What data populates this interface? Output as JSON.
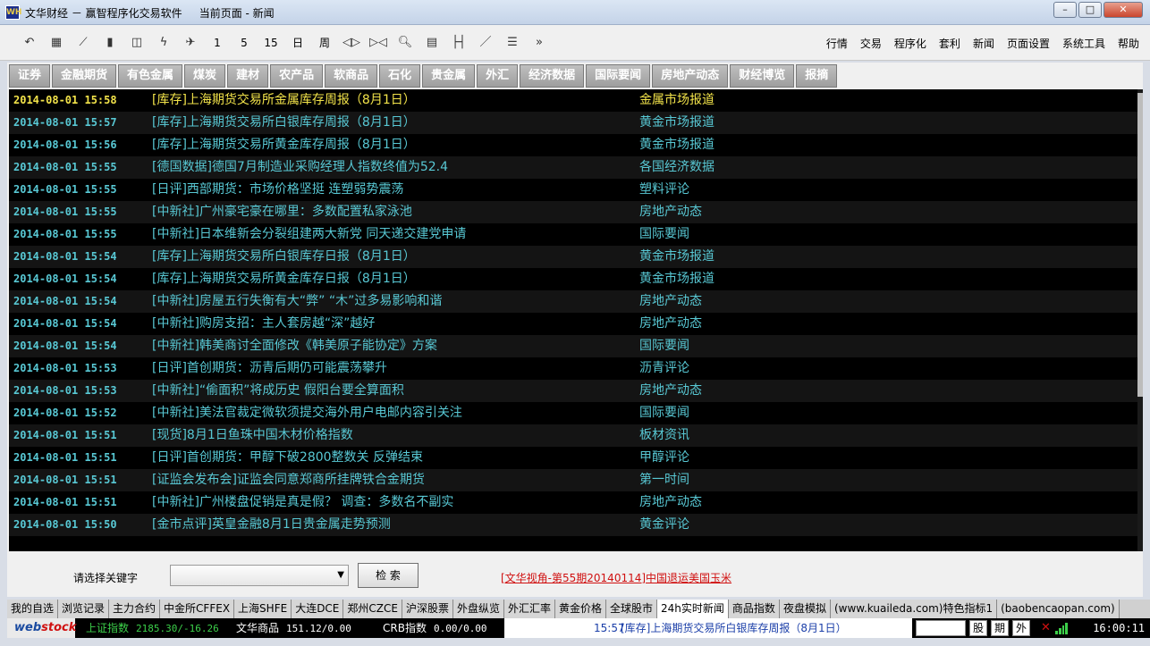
{
  "window": {
    "title": "文华财经 － 赢智程序化交易软件     当前页面 - 新闻",
    "icon_text": "WH",
    "controls": [
      "minimize",
      "maximize",
      "close"
    ]
  },
  "toolbar": {
    "icons": [
      "undo-icon",
      "table-icon",
      "line-chart-icon",
      "candle-icon",
      "split-icon",
      "lightning-icon",
      "plane-icon"
    ],
    "periods": [
      "1",
      "5",
      "15",
      "日",
      "周"
    ],
    "tools": [
      "arrows-icon",
      "arrows2-icon",
      "search-icon",
      "calculator-icon",
      "range-icon",
      "line-icon",
      "list-icon",
      "more-icon"
    ],
    "menu": [
      "行情",
      "交易",
      "程序化",
      "套利",
      "新闻",
      "页面设置",
      "系统工具",
      "帮助"
    ]
  },
  "category_tabs": [
    "证券",
    "金融期货",
    "有色金属",
    "煤炭",
    "建材",
    "农产品",
    "软商品",
    "石化",
    "贵金属",
    "外汇",
    "经济数据",
    "国际要闻",
    "房地产动态",
    "财经博览",
    "报摘"
  ],
  "news": [
    {
      "time": "2014-08-01 15:58",
      "title": "[库存]上海期货交易所金属库存周报（8月1日）",
      "category": "金属市场报道",
      "highlight": true
    },
    {
      "time": "2014-08-01 15:57",
      "title": "[库存]上海期货交易所白银库存周报（8月1日）",
      "category": "黄金市场报道"
    },
    {
      "time": "2014-08-01 15:56",
      "title": "[库存]上海期货交易所黄金库存周报（8月1日）",
      "category": "黄金市场报道"
    },
    {
      "time": "2014-08-01 15:55",
      "title": "[德国数据]德国7月制造业采购经理人指数终值为52.4",
      "category": "各国经济数据"
    },
    {
      "time": "2014-08-01 15:55",
      "title": "[日评]西部期货：市场价格坚挺 连塑弱势震荡",
      "category": "塑料评论"
    },
    {
      "time": "2014-08-01 15:55",
      "title": "[中新社]广州豪宅豪在哪里：多数配置私家泳池",
      "category": "房地产动态"
    },
    {
      "time": "2014-08-01 15:55",
      "title": "[中新社]日本维新会分裂组建两大新党 同天递交建党申请",
      "category": "国际要闻"
    },
    {
      "time": "2014-08-01 15:54",
      "title": "[库存]上海期货交易所白银库存日报（8月1日）",
      "category": "黄金市场报道"
    },
    {
      "time": "2014-08-01 15:54",
      "title": "[库存]上海期货交易所黄金库存日报（8月1日）",
      "category": "黄金市场报道"
    },
    {
      "time": "2014-08-01 15:54",
      "title": "[中新社]房屋五行失衡有大“弊” “木”过多易影响和谐",
      "category": "房地产动态"
    },
    {
      "time": "2014-08-01 15:54",
      "title": "[中新社]购房支招：主人套房越“深”越好",
      "category": "房地产动态"
    },
    {
      "time": "2014-08-01 15:54",
      "title": "[中新社]韩美商讨全面修改《韩美原子能协定》方案",
      "category": "国际要闻"
    },
    {
      "time": "2014-08-01 15:53",
      "title": "[日评]首创期货：沥青后期仍可能震荡攀升",
      "category": "沥青评论"
    },
    {
      "time": "2014-08-01 15:53",
      "title": "[中新社]“偷面积”将成历史 假阳台要全算面积",
      "category": "房地产动态"
    },
    {
      "time": "2014-08-01 15:52",
      "title": "[中新社]美法官裁定微软须提交海外用户电邮内容引关注",
      "category": "国际要闻"
    },
    {
      "time": "2014-08-01 15:51",
      "title": "[现货]8月1日鱼珠中国木材价格指数",
      "category": "板材资讯"
    },
    {
      "time": "2014-08-01 15:51",
      "title": "[日评]首创期货：甲醇下破2800整数关 反弹结束",
      "category": "甲醇评论"
    },
    {
      "time": "2014-08-01 15:51",
      "title": "[证监会发布会]证监会同意郑商所挂牌铁合金期货",
      "category": "第一时间"
    },
    {
      "time": "2014-08-01 15:51",
      "title": "[中新社]广州楼盘促销是真是假？ 调查：多数名不副实",
      "category": "房地产动态"
    },
    {
      "time": "2014-08-01 15:50",
      "title": "[金市点评]英皇金融8月1日贵金属走势预测",
      "category": "黄金评论"
    }
  ],
  "search": {
    "label": "请选择关键字",
    "select_value": "",
    "button": "检 索",
    "promo": "[文华视角-第55期20140114]中国退运美国玉米"
  },
  "bottom_tabs": [
    "我的自选",
    "浏览记录",
    "主力合约",
    "中金所CFFEX",
    "上海SHFE",
    "大连DCE",
    "郑州CZCE",
    "沪深股票",
    "外盘纵览",
    "外汇汇率",
    "黄金价格",
    "全球股市",
    "24h实时新闻",
    "商品指数",
    "夜盘模拟",
    "(www.kuaileda.com)特色指标1",
    "(baobencaopan.com)"
  ],
  "active_bottom_tab": "24h实时新闻",
  "status": {
    "logo_a": "web",
    "logo_b": "stock",
    "indices": [
      {
        "label": "上证指数",
        "value": "2185.30/-16.26",
        "color": "#3cd04a"
      },
      {
        "label": "文华商品",
        "value": "151.12/0.00",
        "color": "#ffffff"
      },
      {
        "label": "CRB指数",
        "value": "0.00/0.00",
        "color": "#ffffff"
      }
    ],
    "ticker_time": "15:57",
    "ticker_msg": "[库存]上海期货交易所白银库存周报（8月1日）",
    "buttons": [
      "股",
      "期",
      "外"
    ],
    "clock": "16:00:11"
  },
  "colors": {
    "news_text": "#58c8d4",
    "news_highlight": "#f2e34a",
    "promo": "#d01010"
  }
}
